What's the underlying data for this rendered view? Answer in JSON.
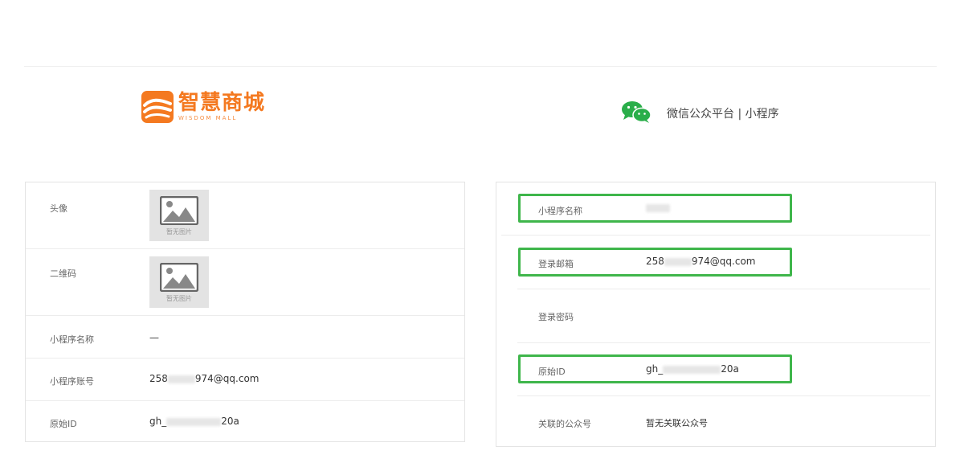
{
  "brand": {
    "name": "智慧商城",
    "subtitle": "WISDOM MALL",
    "icon": "wave-logo-icon",
    "color": "#f47920"
  },
  "platform": {
    "icon": "wechat-icon",
    "name": "微信公众平台 | 小程序",
    "color": "#2aae4a"
  },
  "left_panel": {
    "rows": [
      {
        "label": "头像",
        "image_text": "暂无图片"
      },
      {
        "label": "二维码",
        "image_text": "暂无图片"
      },
      {
        "label": "小程序名称",
        "value": "—"
      },
      {
        "label": "小程序账号",
        "value_prefix": "258",
        "value_suffix": "974@qq.com"
      },
      {
        "label": "原始ID",
        "value_prefix": "gh_",
        "value_suffix": "20a"
      }
    ]
  },
  "right_panel": {
    "highlight_color": "#3fb64b",
    "rows": [
      {
        "label": "小程序名称",
        "value": "",
        "highlighted": true
      },
      {
        "label": "登录邮箱",
        "value_prefix": "258",
        "value_suffix": "974@qq.com",
        "highlighted": true
      },
      {
        "label": "登录密码",
        "value": "",
        "highlighted": false
      },
      {
        "label": "原始ID",
        "value_prefix": "gh_",
        "value_suffix": "20a",
        "highlighted": true
      },
      {
        "label": "关联的公众号",
        "value": "暂无关联公众号",
        "highlighted": false
      }
    ]
  }
}
